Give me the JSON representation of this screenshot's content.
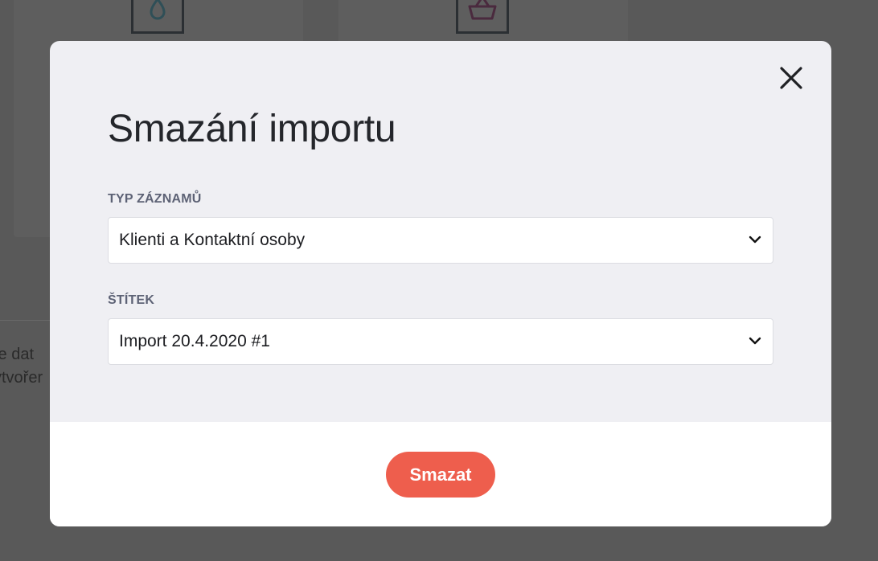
{
  "background": {
    "text_line_1": "te dat",
    "text_line_2": "ytvořer",
    "icons": [
      "drop-icon",
      "basket-icon"
    ]
  },
  "modal": {
    "title": "Smazání importu",
    "close_icon": "close-icon",
    "fields": [
      {
        "label": "TYP ZÁZNAMŮ",
        "value": "Klienti a Kontaktní osoby",
        "icon": "chevron-down-icon"
      },
      {
        "label": "ŠTÍTEK",
        "value": "Import 20.4.2020 #1",
        "icon": "chevron-down-icon"
      }
    ],
    "delete_label": "Smazat"
  },
  "colors": {
    "overlay": "#595959",
    "modal_bg": "#efeff3",
    "accent": "#ee5e4d",
    "label": "#5d6275",
    "text": "#24262b",
    "bg_icon_drop": "#2f4f57",
    "bg_icon_basket": "#4a2a3e"
  }
}
